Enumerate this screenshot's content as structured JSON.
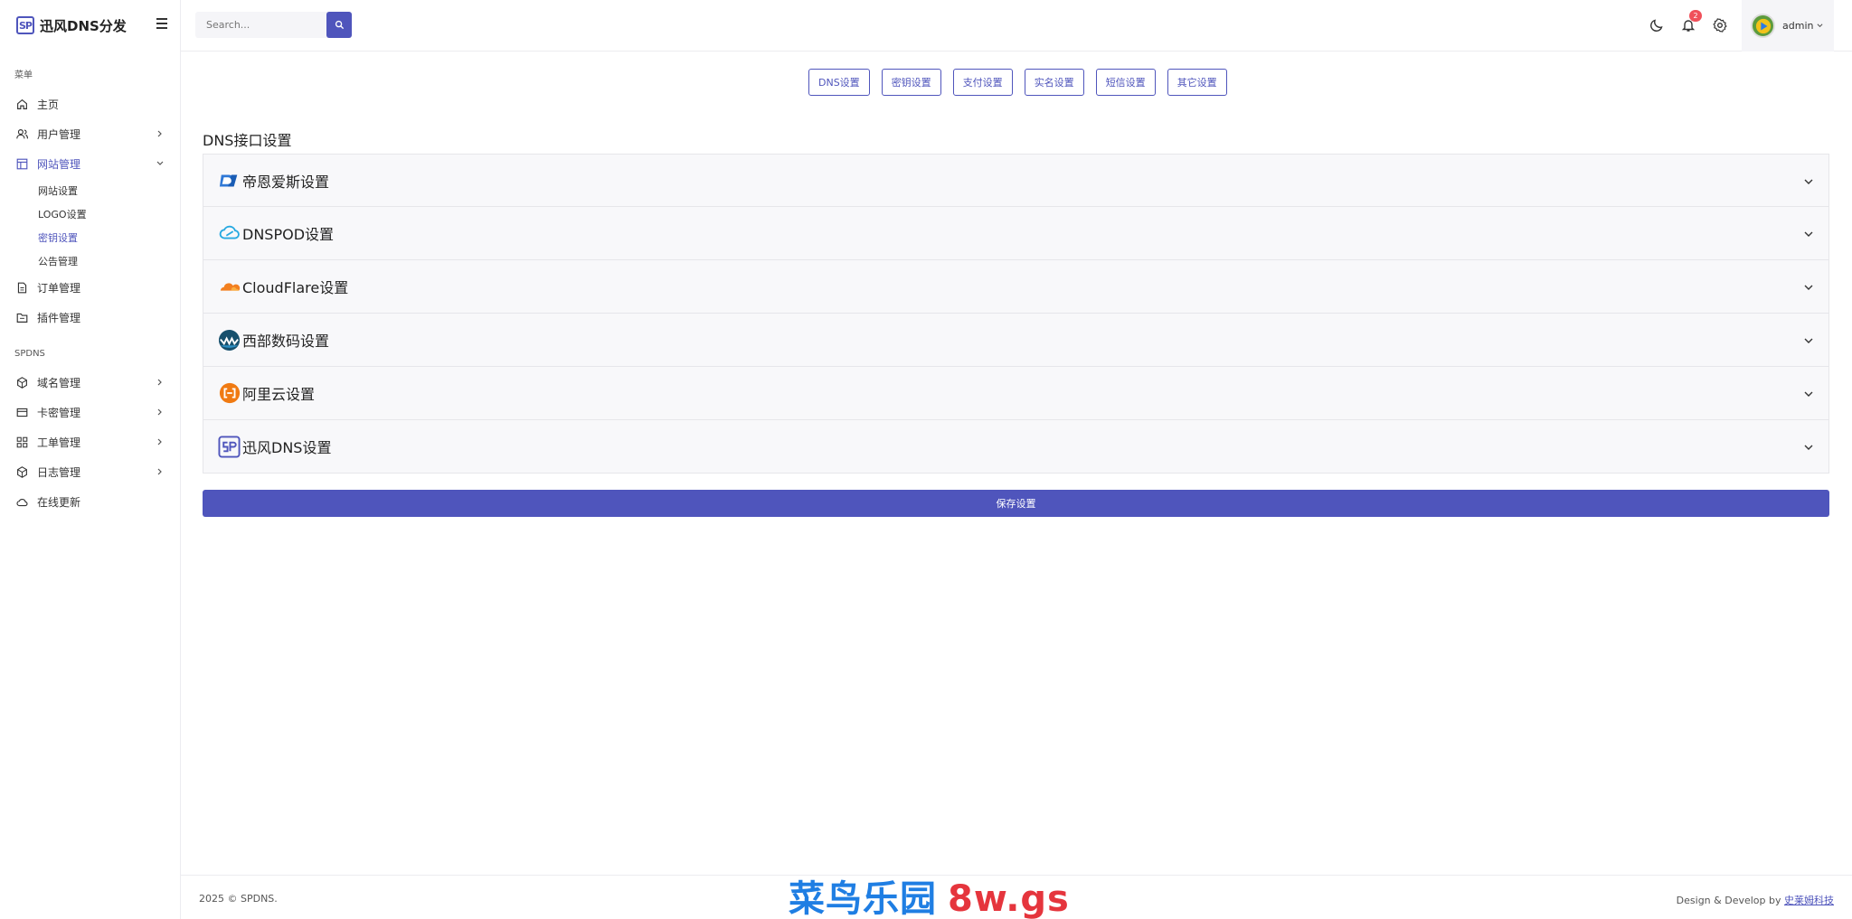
{
  "brand": {
    "logo_text": "SP",
    "title": "迅风DNS分发"
  },
  "sidebar": {
    "section1_title": "菜单",
    "home": "主页",
    "users": "用户管理",
    "site": "网站管理",
    "site_sub": [
      "网站设置",
      "LOGO设置",
      "密钥设置",
      "公告管理"
    ],
    "orders": "订单管理",
    "plugins": "插件管理",
    "section2_title": "SPDNS",
    "domains": "域名管理",
    "cards": "卡密管理",
    "tickets": "工单管理",
    "logs": "日志管理",
    "update": "在线更新"
  },
  "header": {
    "search_placeholder": "Search...",
    "notification_count": "2",
    "user_name": "admin"
  },
  "tabs": [
    "DNS设置",
    "密钥设置",
    "支付设置",
    "实名设置",
    "短信设置",
    "其它设置"
  ],
  "main": {
    "section_title": "DNS接口设置",
    "providers": [
      {
        "label": "帝恩爱斯设置",
        "icon": "dns-la-icon"
      },
      {
        "label": "DNSPOD设置",
        "icon": "dnspod-icon"
      },
      {
        "label": "CloudFlare设置",
        "icon": "cloudflare-icon"
      },
      {
        "label": "西部数码设置",
        "icon": "west-digital-icon"
      },
      {
        "label": "阿里云设置",
        "icon": "aliyun-icon"
      },
      {
        "label": "迅风DNS设置",
        "icon": "spdns-icon"
      }
    ],
    "save_label": "保存设置"
  },
  "footer": {
    "copyright": "2025 © SPDNS.",
    "credit_prefix": "Design & Develop by ",
    "credit_link": "史莱姆科技",
    "watermark_a": "菜鸟乐园",
    "watermark_b": "8w.gs"
  },
  "colors": {
    "accent": "#4f55bc",
    "badge": "#f0505a"
  }
}
